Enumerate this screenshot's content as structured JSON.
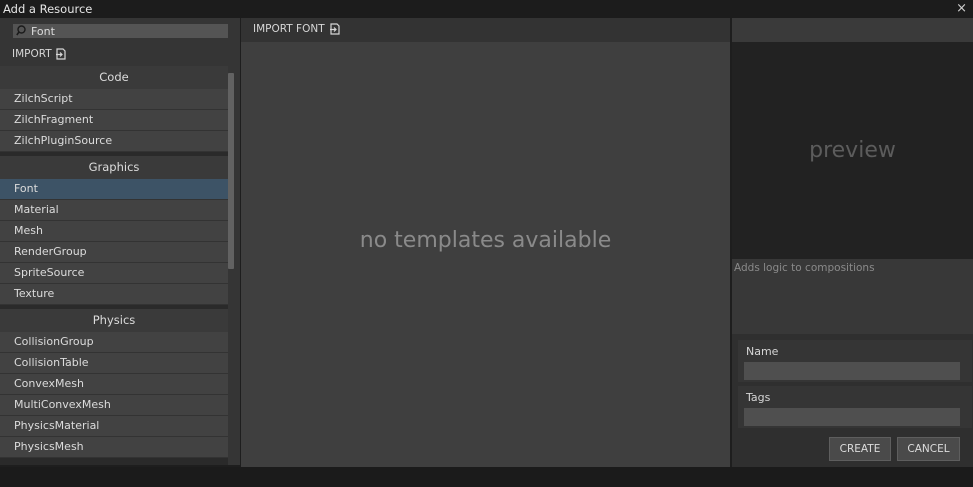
{
  "window": {
    "title": "Add a Resource",
    "close_glyph": "×"
  },
  "search": {
    "value": "Font",
    "placeholder": ""
  },
  "left_import": {
    "label": "IMPORT",
    "icon": "import-icon"
  },
  "categories": [
    {
      "name": "Code",
      "items": [
        "ZilchScript",
        "ZilchFragment",
        "ZilchPluginSource"
      ]
    },
    {
      "name": "Graphics",
      "items": [
        "Font",
        "Material",
        "Mesh",
        "RenderGroup",
        "SpriteSource",
        "Texture"
      ]
    },
    {
      "name": "Physics",
      "items": [
        "CollisionGroup",
        "CollisionTable",
        "ConvexMesh",
        "MultiConvexMesh",
        "PhysicsMaterial",
        "PhysicsMesh"
      ]
    }
  ],
  "selected_item": "Font",
  "middle": {
    "import_label": "IMPORT FONT",
    "empty_message": "no templates available"
  },
  "right": {
    "preview_label": "preview",
    "description": "Adds logic to compositions",
    "name_label": "Name",
    "name_value": "",
    "tags_label": "Tags",
    "tags_value": "",
    "create_label": "CREATE",
    "cancel_label": "CANCEL"
  },
  "colors": {
    "selected_row": "#3d5366",
    "background": "#1e1e1e"
  }
}
